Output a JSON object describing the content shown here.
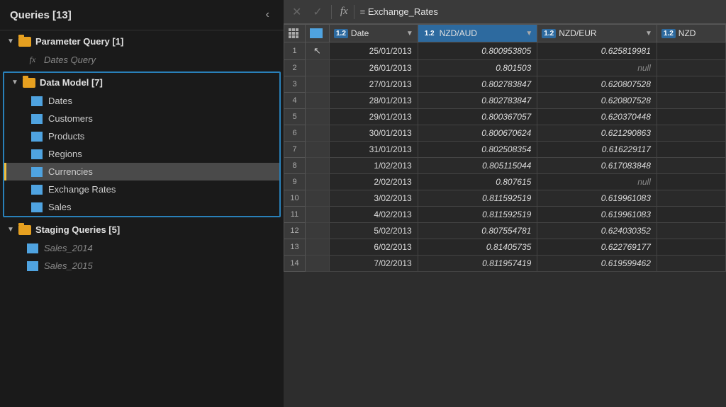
{
  "sidebar": {
    "title": "Queries [13]",
    "collapse_label": "‹",
    "groups": [
      {
        "id": "parameter",
        "label": "Parameter Query [1]",
        "expanded": true,
        "items": [
          {
            "id": "dates-query",
            "label": "Dates Query",
            "type": "fx",
            "italic": true
          }
        ]
      },
      {
        "id": "data-model",
        "label": "Data Model [7]",
        "expanded": true,
        "items": [
          {
            "id": "dates",
            "label": "Dates",
            "type": "table",
            "italic": false
          },
          {
            "id": "customers",
            "label": "Customers",
            "type": "table",
            "italic": false
          },
          {
            "id": "products",
            "label": "Products",
            "type": "table",
            "italic": false
          },
          {
            "id": "regions",
            "label": "Regions",
            "type": "table",
            "italic": false
          },
          {
            "id": "currencies",
            "label": "Currencies",
            "type": "table",
            "italic": false,
            "selected": true
          },
          {
            "id": "exchange-rates",
            "label": "Exchange Rates",
            "type": "table",
            "italic": false
          },
          {
            "id": "sales",
            "label": "Sales",
            "type": "table",
            "italic": false
          }
        ]
      },
      {
        "id": "staging",
        "label": "Staging Queries [5]",
        "expanded": true,
        "items": [
          {
            "id": "sales-2014",
            "label": "Sales_2014",
            "type": "table",
            "italic": true
          },
          {
            "id": "sales-2015",
            "label": "Sales_2015",
            "type": "table",
            "italic": true
          }
        ]
      }
    ]
  },
  "formula_bar": {
    "cancel_label": "✕",
    "confirm_label": "✓",
    "fx_label": "fx",
    "formula_value": "= Exchange_Rates"
  },
  "table": {
    "columns": [
      {
        "id": "row-num",
        "label": ""
      },
      {
        "id": "grid-icon",
        "label": ""
      },
      {
        "id": "date",
        "label": "Date",
        "type": "1.2",
        "has_dropdown": true
      },
      {
        "id": "nzd-aud",
        "label": "NZD/AUD",
        "type": "1.2",
        "has_dropdown": true,
        "highlight": true
      },
      {
        "id": "nzd-eur",
        "label": "NZD/EUR",
        "type": "1.2",
        "has_dropdown": true
      },
      {
        "id": "nzd-x",
        "label": "NZD",
        "type": "1.2",
        "has_dropdown": false,
        "truncated": true
      }
    ],
    "rows": [
      {
        "num": "1",
        "date": "25/01/2013",
        "nzd_aud": "0.800953805",
        "nzd_eur": "0.625819981",
        "nzd_x": ""
      },
      {
        "num": "2",
        "date": "26/01/2013",
        "nzd_aud": "0.801503",
        "nzd_eur": "null",
        "nzd_x": ""
      },
      {
        "num": "3",
        "date": "27/01/2013",
        "nzd_aud": "0.802783847",
        "nzd_eur": "0.620807528",
        "nzd_x": ""
      },
      {
        "num": "4",
        "date": "28/01/2013",
        "nzd_aud": "0.802783847",
        "nzd_eur": "0.620807528",
        "nzd_x": ""
      },
      {
        "num": "5",
        "date": "29/01/2013",
        "nzd_aud": "0.800367057",
        "nzd_eur": "0.620370448",
        "nzd_x": ""
      },
      {
        "num": "6",
        "date": "30/01/2013",
        "nzd_aud": "0.800670624",
        "nzd_eur": "0.621290863",
        "nzd_x": ""
      },
      {
        "num": "7",
        "date": "31/01/2013",
        "nzd_aud": "0.802508354",
        "nzd_eur": "0.616229117",
        "nzd_x": ""
      },
      {
        "num": "8",
        "date": "1/02/2013",
        "nzd_aud": "0.805115044",
        "nzd_eur": "0.617083848",
        "nzd_x": ""
      },
      {
        "num": "9",
        "date": "2/02/2013",
        "nzd_aud": "0.807615",
        "nzd_eur": "null",
        "nzd_x": ""
      },
      {
        "num": "10",
        "date": "3/02/2013",
        "nzd_aud": "0.811592519",
        "nzd_eur": "0.619961083",
        "nzd_x": ""
      },
      {
        "num": "11",
        "date": "4/02/2013",
        "nzd_aud": "0.811592519",
        "nzd_eur": "0.619961083",
        "nzd_x": ""
      },
      {
        "num": "12",
        "date": "5/02/2013",
        "nzd_aud": "0.807554781",
        "nzd_eur": "0.624030352",
        "nzd_x": ""
      },
      {
        "num": "13",
        "date": "6/02/2013",
        "nzd_aud": "0.81405735",
        "nzd_eur": "0.622769177",
        "nzd_x": ""
      },
      {
        "num": "14",
        "date": "7/02/2013",
        "nzd_aud": "0.811957419",
        "nzd_eur": "0.619599462",
        "nzd_x": ""
      }
    ]
  }
}
